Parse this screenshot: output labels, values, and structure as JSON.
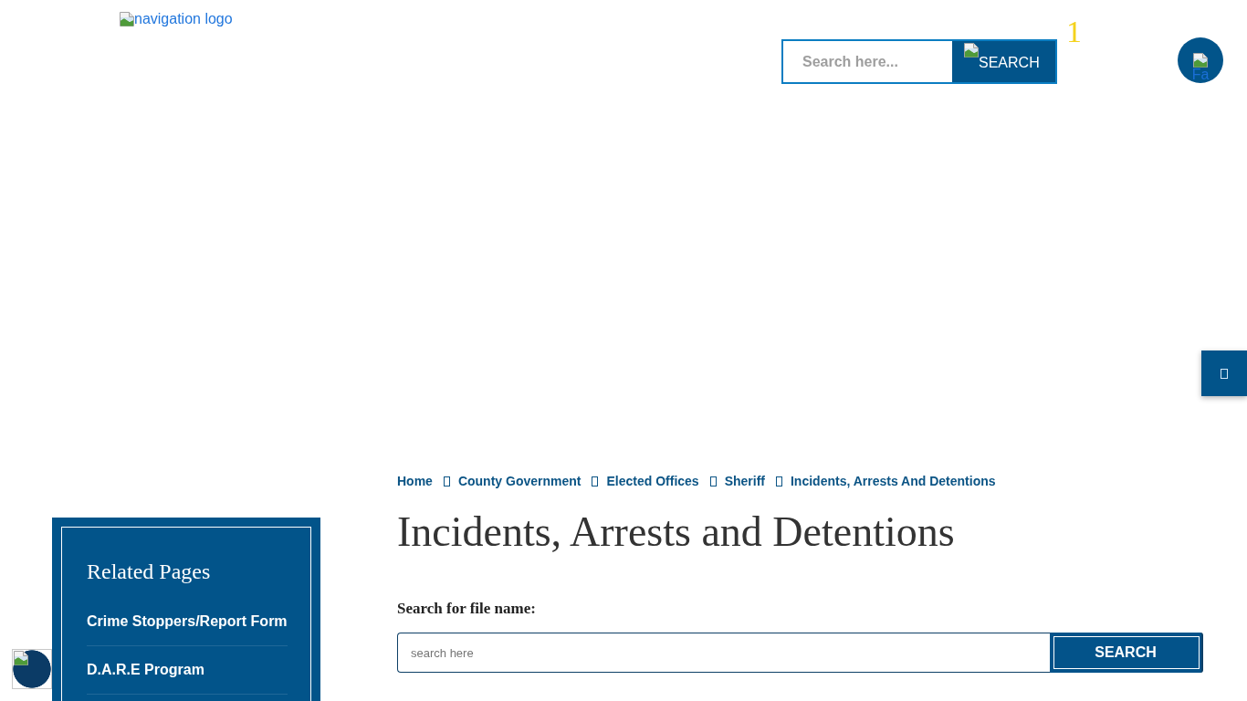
{
  "header": {
    "logo": {
      "alt_text": "navigation logo"
    },
    "search": {
      "placeholder": "Search here...",
      "button": "SEARCH"
    },
    "badge": "1",
    "social_button": {
      "alt_text": "Fa"
    }
  },
  "breadcrumb": [
    {
      "label": "Home"
    },
    {
      "label": "County Government"
    },
    {
      "label": "Elected Offices"
    },
    {
      "label": "Sheriff"
    },
    {
      "label": "Incidents, Arrests And Detentions"
    }
  ],
  "page_title": "Incidents, Arrests and Detentions",
  "sidebar": {
    "title": "Related Pages",
    "items": [
      {
        "label": "Crime Stoppers/Report Form"
      },
      {
        "label": "D.A.R.E Program"
      }
    ]
  },
  "file_search": {
    "label": "Search for file name:",
    "placeholder": "search here",
    "button": "SEARCH"
  }
}
